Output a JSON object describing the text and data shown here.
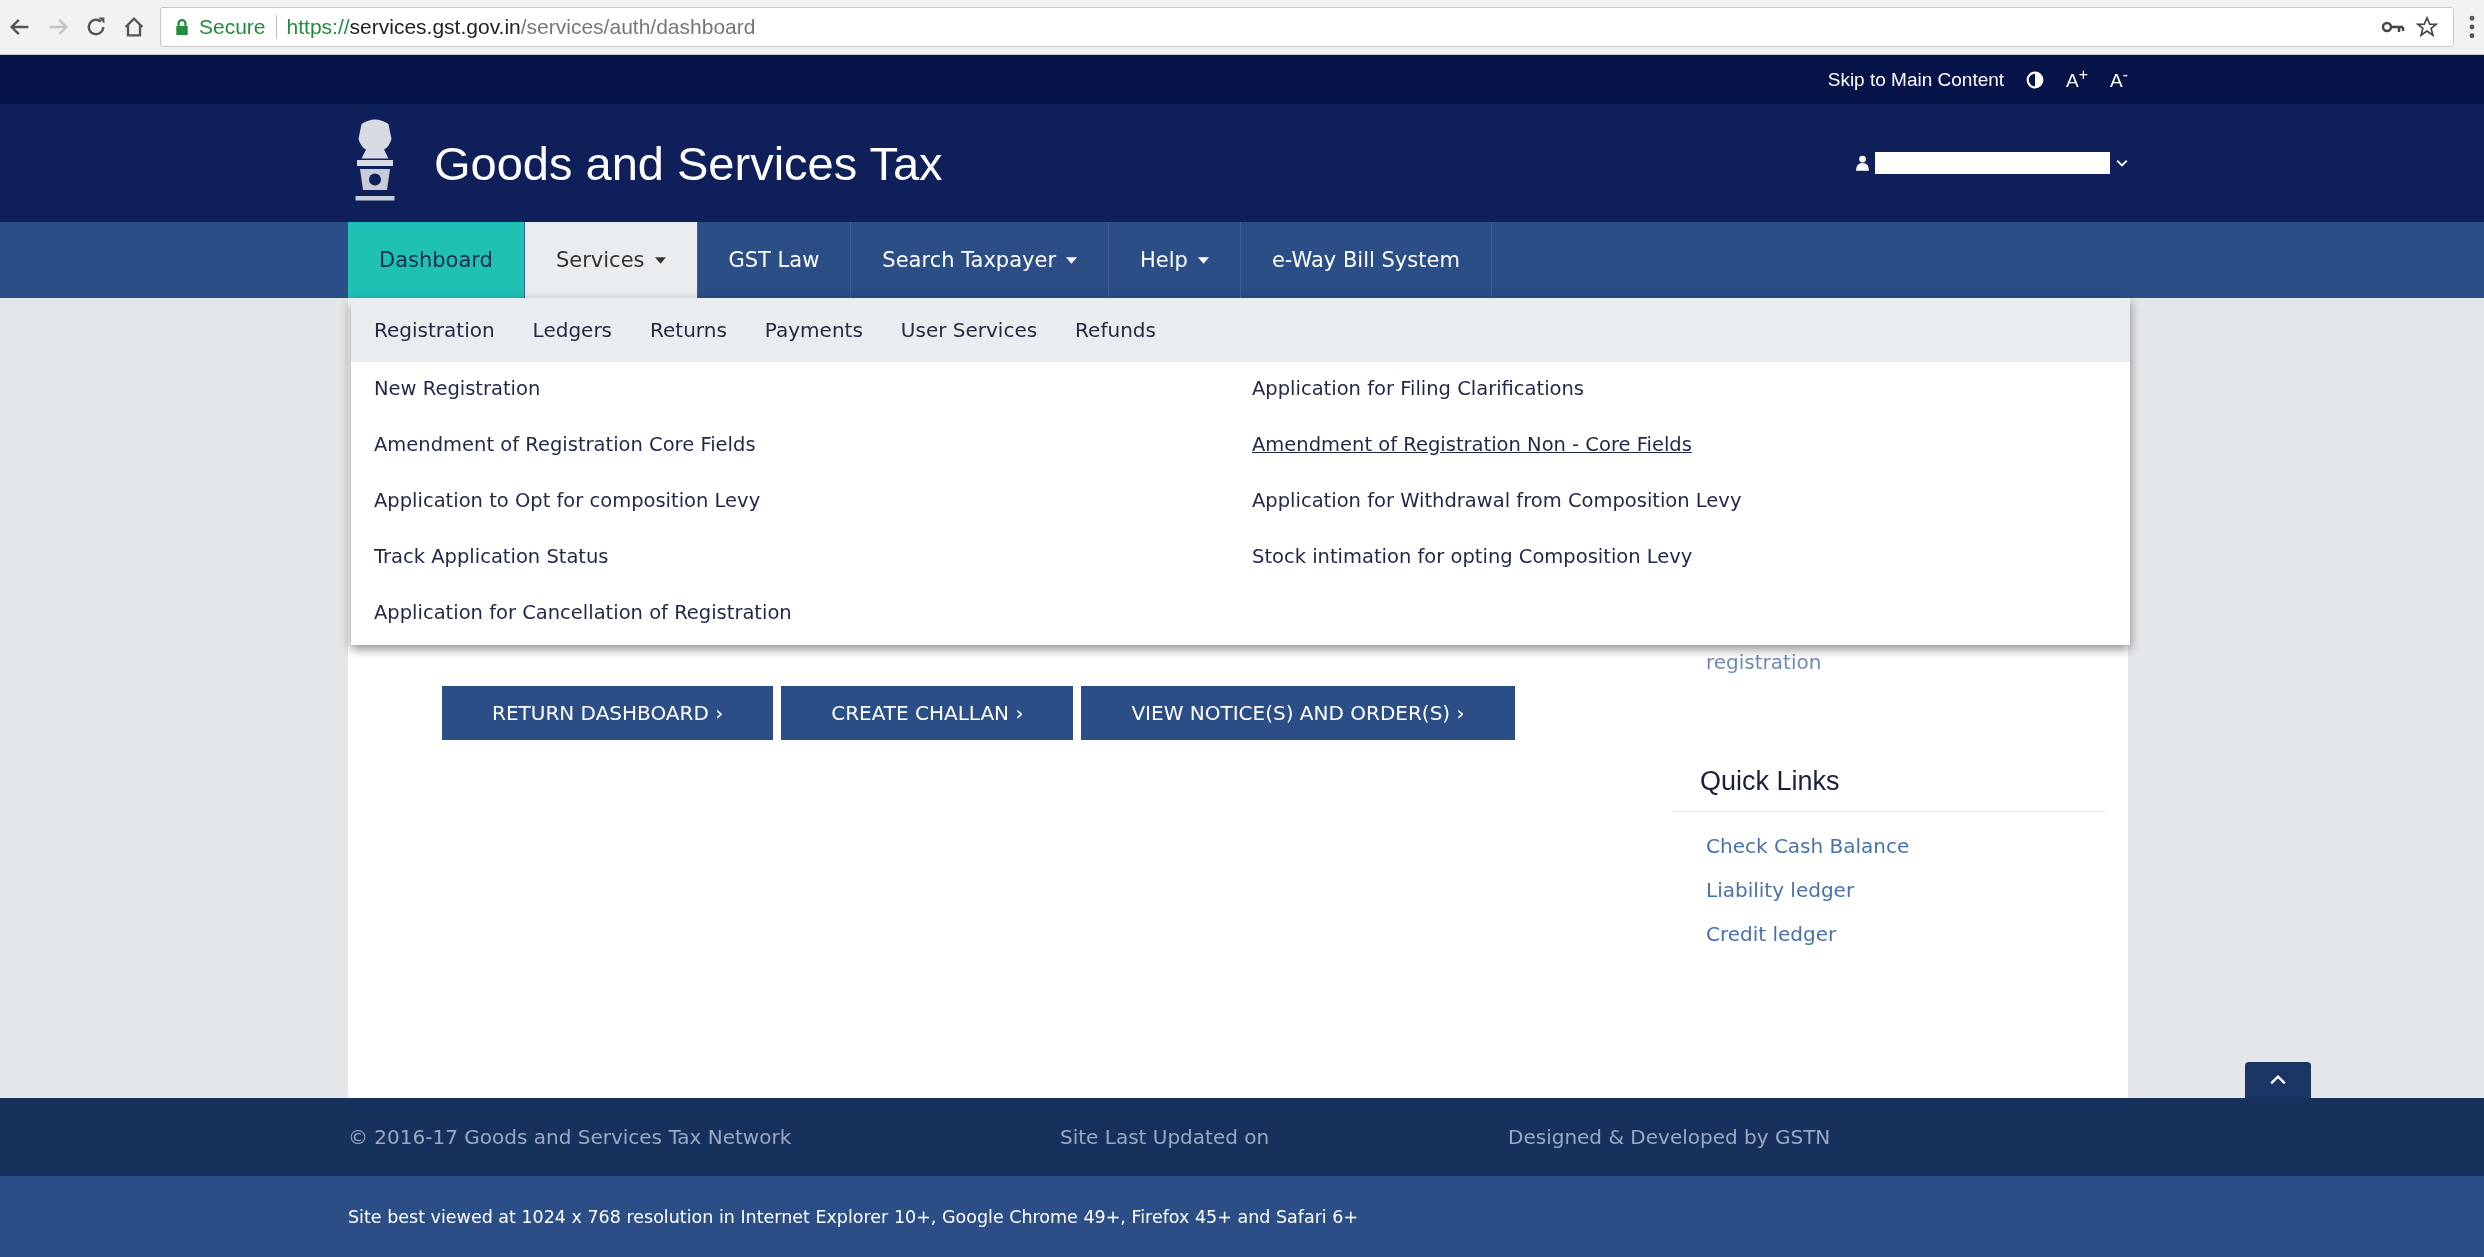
{
  "browser": {
    "security_label": "Secure",
    "url_scheme": "https://",
    "url_host": "services.gst.gov.in",
    "url_path": "/services/auth/dashboard",
    "forward_disabled": true
  },
  "top_strip": {
    "skip_link": "Skip to Main Content",
    "font_increase": "A$^{+}$",
    "font_decrease": "A$^{-}$"
  },
  "header": {
    "title": "Goods and Services Tax"
  },
  "nav": [
    {
      "label": "Dashboard",
      "selected": true,
      "expanded": false,
      "has_menu": false
    },
    {
      "label": "Services",
      "selected": false,
      "expanded": true,
      "has_menu": true
    },
    {
      "label": "GST Law",
      "selected": false,
      "expanded": false,
      "has_menu": false
    },
    {
      "label": "Search Taxpayer",
      "selected": false,
      "expanded": false,
      "has_menu": true
    },
    {
      "label": "Help",
      "selected": false,
      "expanded": false,
      "has_menu": true
    },
    {
      "label": "e-Way Bill System",
      "selected": false,
      "expanded": false,
      "has_menu": false
    }
  ],
  "dropdown": {
    "tabs": [
      "Registration",
      "Ledgers",
      "Returns",
      "Payments",
      "User Services",
      "Refunds"
    ],
    "columns": [
      [
        {
          "label": "New Registration",
          "hovered": false
        },
        {
          "label": "Amendment of Registration Core Fields",
          "hovered": false
        },
        {
          "label": "Application to Opt for composition Levy",
          "hovered": false
        },
        {
          "label": "Track Application Status",
          "hovered": false
        },
        {
          "label": "Application for Cancellation of Registration",
          "hovered": false
        }
      ],
      [
        {
          "label": "Application for Filing Clarifications",
          "hovered": false
        },
        {
          "label": "Amendment of Registration Non - Core Fields",
          "hovered": true
        },
        {
          "label": "Application for Withdrawal from Composition Levy",
          "hovered": false
        },
        {
          "label": "Stock intimation for opting Composition Levy",
          "hovered": false
        }
      ]
    ]
  },
  "partial_text": "registration",
  "buttons": [
    "RETURN DASHBOARD ›",
    "CREATE CHALLAN ›",
    "VIEW NOTICE(S) AND ORDER(S) ›"
  ],
  "quick_links": {
    "title": "Quick Links",
    "links": [
      "Check Cash Balance",
      "Liability ledger",
      "Credit ledger"
    ]
  },
  "footer": {
    "copyright": "© 2016-17 Goods and Services Tax Network",
    "updated": "Site Last Updated on",
    "developer": "Designed & Developed by GSTN",
    "note": "Site best viewed at 1024 x 768 resolution in Internet Explorer 10+, Google Chrome 49+, Firefox 45+ and Safari 6+"
  }
}
